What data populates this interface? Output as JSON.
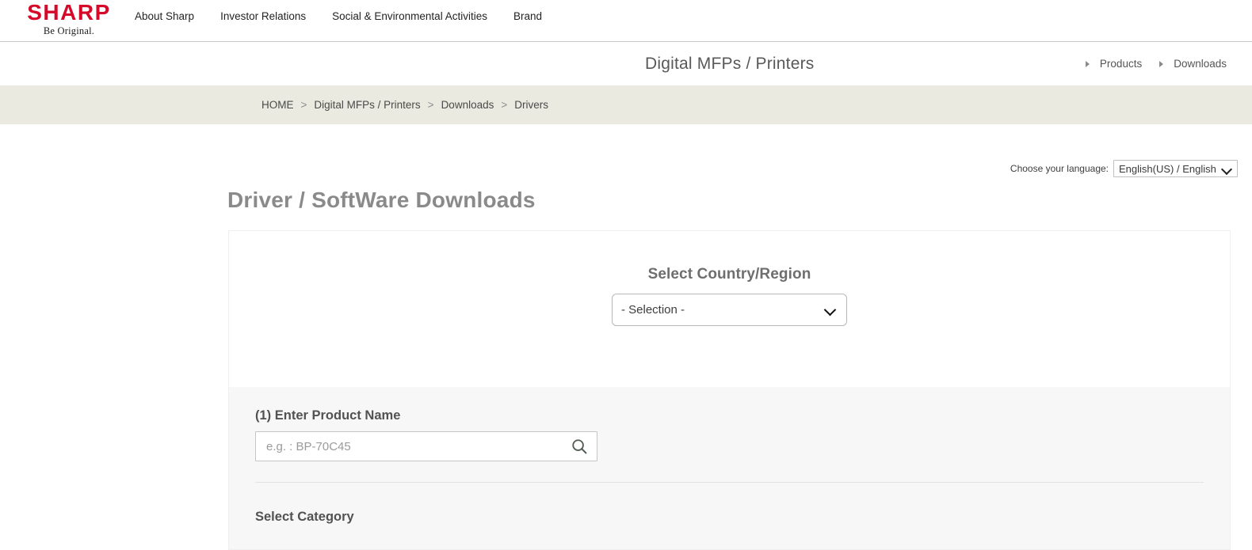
{
  "brand": {
    "logo_text": "SHARP",
    "tagline": "Be Original.",
    "logo_color": "#d5092a"
  },
  "global_nav": {
    "items": [
      {
        "label": "About Sharp"
      },
      {
        "label": "Investor Relations"
      },
      {
        "label": "Social & Environmental Activities"
      },
      {
        "label": "Brand"
      }
    ]
  },
  "section_bar": {
    "title": "Digital MFPs / Printers",
    "links": [
      {
        "label": "Products"
      },
      {
        "label": "Downloads"
      }
    ]
  },
  "breadcrumb": {
    "items": [
      {
        "label": "HOME"
      },
      {
        "label": "Digital MFPs / Printers"
      },
      {
        "label": "Downloads"
      },
      {
        "label": "Drivers"
      }
    ],
    "separator": ">",
    "background_color": "#eaeae1"
  },
  "language": {
    "label": "Choose your language:",
    "selected": "English(US) / English"
  },
  "page": {
    "title": "Driver / SoftWare Downloads"
  },
  "country": {
    "label": "Select Country/Region",
    "selected": "- Selection -"
  },
  "product_name": {
    "label": "(1) Enter Product Name",
    "placeholder": "e.g. : BP-70C45",
    "value": "",
    "search_icon": "search-icon"
  },
  "category": {
    "label": "Select Category"
  }
}
